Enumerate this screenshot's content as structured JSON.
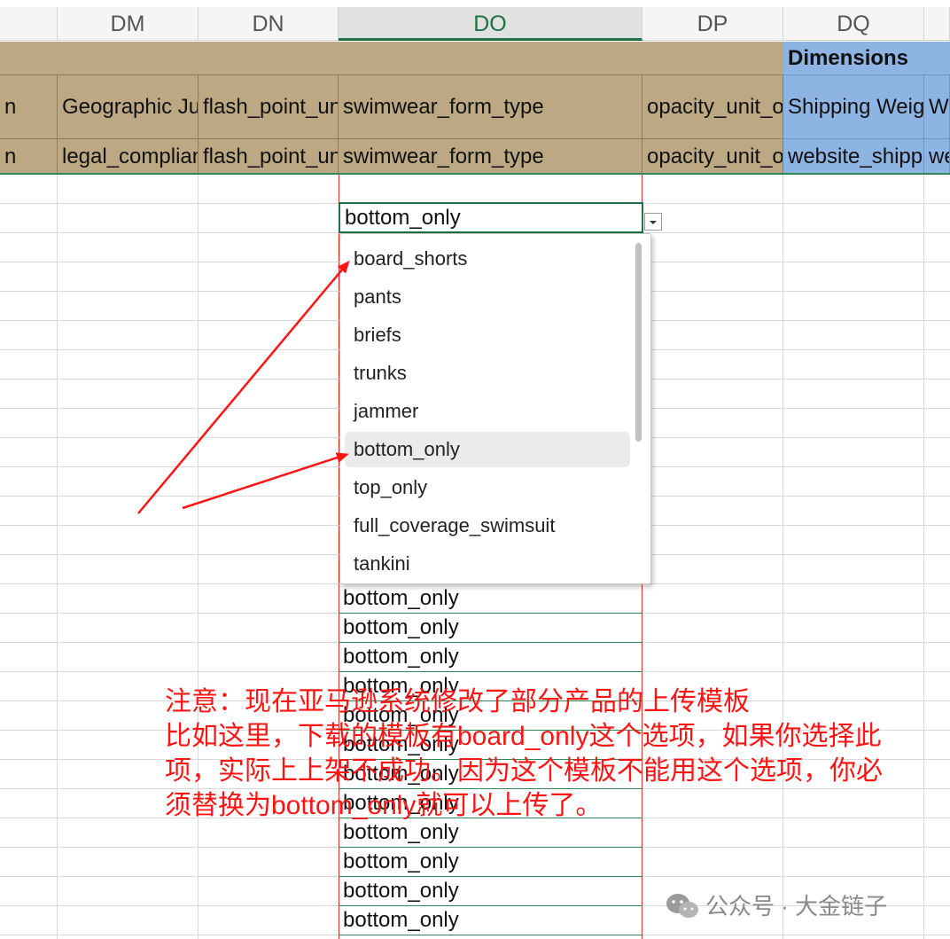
{
  "column_headers": [
    "DM",
    "DN",
    "DO",
    "DP",
    "DQ"
  ],
  "selected_column": "DO",
  "group_header": "Dimensions",
  "header_row_2": [
    "n",
    "Geographic Jurisdiction",
    "flash_point_unit",
    "swimwear_form_type",
    "opacity_unit_of_measure",
    "Shipping Weight",
    "W"
  ],
  "header_row_3": [
    "n",
    "legal_compliance_certification",
    "flash_point_unit",
    "swimwear_form_type",
    "opacity_unit_of_measure",
    "website_shipping_weight",
    "we"
  ],
  "active_cell_value": "bottom_only",
  "dropdown": {
    "options": [
      "board_shorts",
      "pants",
      "briefs",
      "trunks",
      "jammer",
      "bottom_only",
      "top_only",
      "full_coverage_swimsuit",
      "tankini"
    ],
    "selected": "bottom_only"
  },
  "filled_cells": [
    "bottom_only",
    "bottom_only",
    "bottom_only",
    "bottom_only",
    "bottom_only",
    "bottom_only",
    "bottom_only",
    "bottom_only",
    "bottom_only",
    "bottom_only",
    "bottom_only",
    "bottom_only"
  ],
  "annotation": {
    "lines": [
      "注意：现在亚马逊系统修改了部分产品的上传模板",
      "比如这里，下载的模板有board_only这个选项，如果你选择此",
      "项，实际上上架不成功。因为这个模板不能用这个选项，你必",
      "须替换为bottom_only就可以上传了。"
    ]
  },
  "watermark": "公众号 · 大金链子",
  "colors": {
    "header_tan": "#bda884",
    "header_blue": "#8eb4e3",
    "accent_green": "#1e7145",
    "annotation_red": "#ff1414"
  }
}
